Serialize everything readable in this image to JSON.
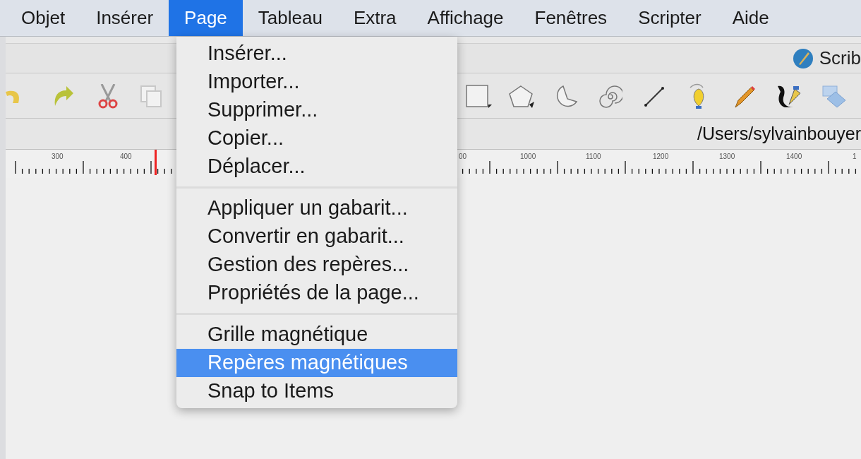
{
  "menubar": [
    {
      "label": "Objet",
      "selected": false
    },
    {
      "label": "Insérer",
      "selected": false
    },
    {
      "label": "Page",
      "selected": true
    },
    {
      "label": "Tableau",
      "selected": false
    },
    {
      "label": "Extra",
      "selected": false
    },
    {
      "label": "Affichage",
      "selected": false
    },
    {
      "label": "Fenêtres",
      "selected": false
    },
    {
      "label": "Scripter",
      "selected": false
    },
    {
      "label": "Aide",
      "selected": false
    }
  ],
  "app_bar": {
    "title": "Scrib"
  },
  "path_bar": {
    "path": "/Users/sylvainbouyer"
  },
  "ruler": {
    "labels": [
      "300",
      "400",
      "00",
      "1000",
      "1100",
      "1200",
      "1300",
      "1400",
      "1"
    ]
  },
  "menu": {
    "groups": [
      [
        {
          "label": "Insérer...",
          "selected": false
        },
        {
          "label": "Importer...",
          "selected": false
        },
        {
          "label": "Supprimer...",
          "selected": false
        },
        {
          "label": "Copier...",
          "selected": false
        },
        {
          "label": "Déplacer...",
          "selected": false
        }
      ],
      [
        {
          "label": "Appliquer un gabarit...",
          "selected": false
        },
        {
          "label": "Convertir en gabarit...",
          "selected": false
        },
        {
          "label": "Gestion des repères...",
          "selected": false
        },
        {
          "label": "Propriétés de la page...",
          "selected": false
        }
      ],
      [
        {
          "label": "Grille magnétique",
          "selected": false
        },
        {
          "label": "Repères magnétiques",
          "selected": true
        },
        {
          "label": "Snap to Items",
          "selected": false
        }
      ]
    ]
  }
}
